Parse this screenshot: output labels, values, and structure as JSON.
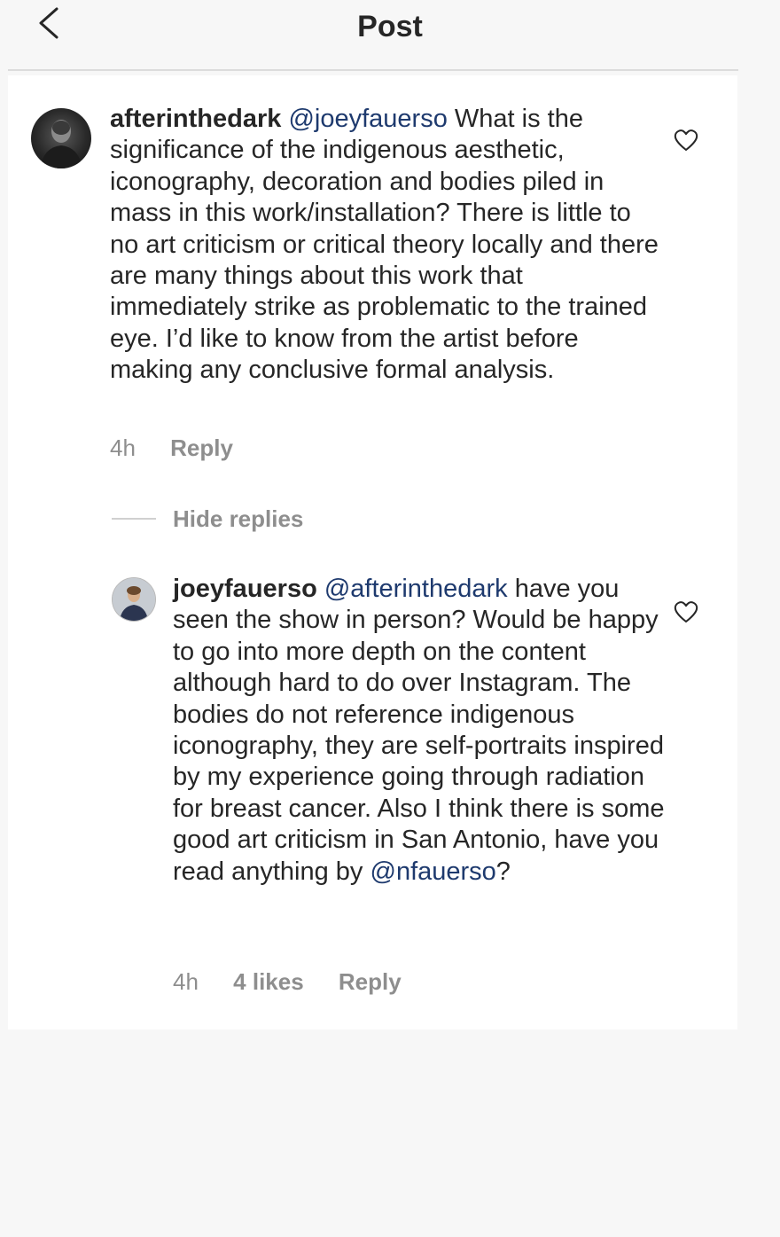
{
  "header": {
    "title": "Post",
    "back_icon": "chevron-left-icon"
  },
  "comment": {
    "username": "afterinthedark",
    "mention": "@joeyfauerso",
    "text": "What is the significance of the indigenous aesthetic, iconography, decoration and bodies piled in mass in this work/installation? There is little to no art criticism or critical theory locally and there are many things about this work that immediately strike as problematic to the trained eye. I’d like to know from the artist before making any conclusive formal analysis.",
    "time": "4h",
    "reply_label": "Reply",
    "like_icon": "heart-outline-icon"
  },
  "replies_toggle": {
    "label": "Hide replies"
  },
  "reply": {
    "username": "joeyfauerso",
    "mention": "@afterinthedark",
    "text": "have you seen the show in person? Would be happy to go into more depth on the content although hard to do over Instagram. The bodies do not reference indigenous iconography, they are self-portraits inspired by my experience going through radiation for breast cancer. Also I think there is some good art criticism in San Antonio, have you read anything by",
    "mention_inline": "@nfauerso",
    "text_end": "?",
    "time": "4h",
    "likes": "4 likes",
    "reply_label": "Reply",
    "like_icon": "heart-outline-icon"
  },
  "colors": {
    "mention": "#1e3a6e",
    "meta": "#8e8e8e",
    "text": "#262626"
  }
}
